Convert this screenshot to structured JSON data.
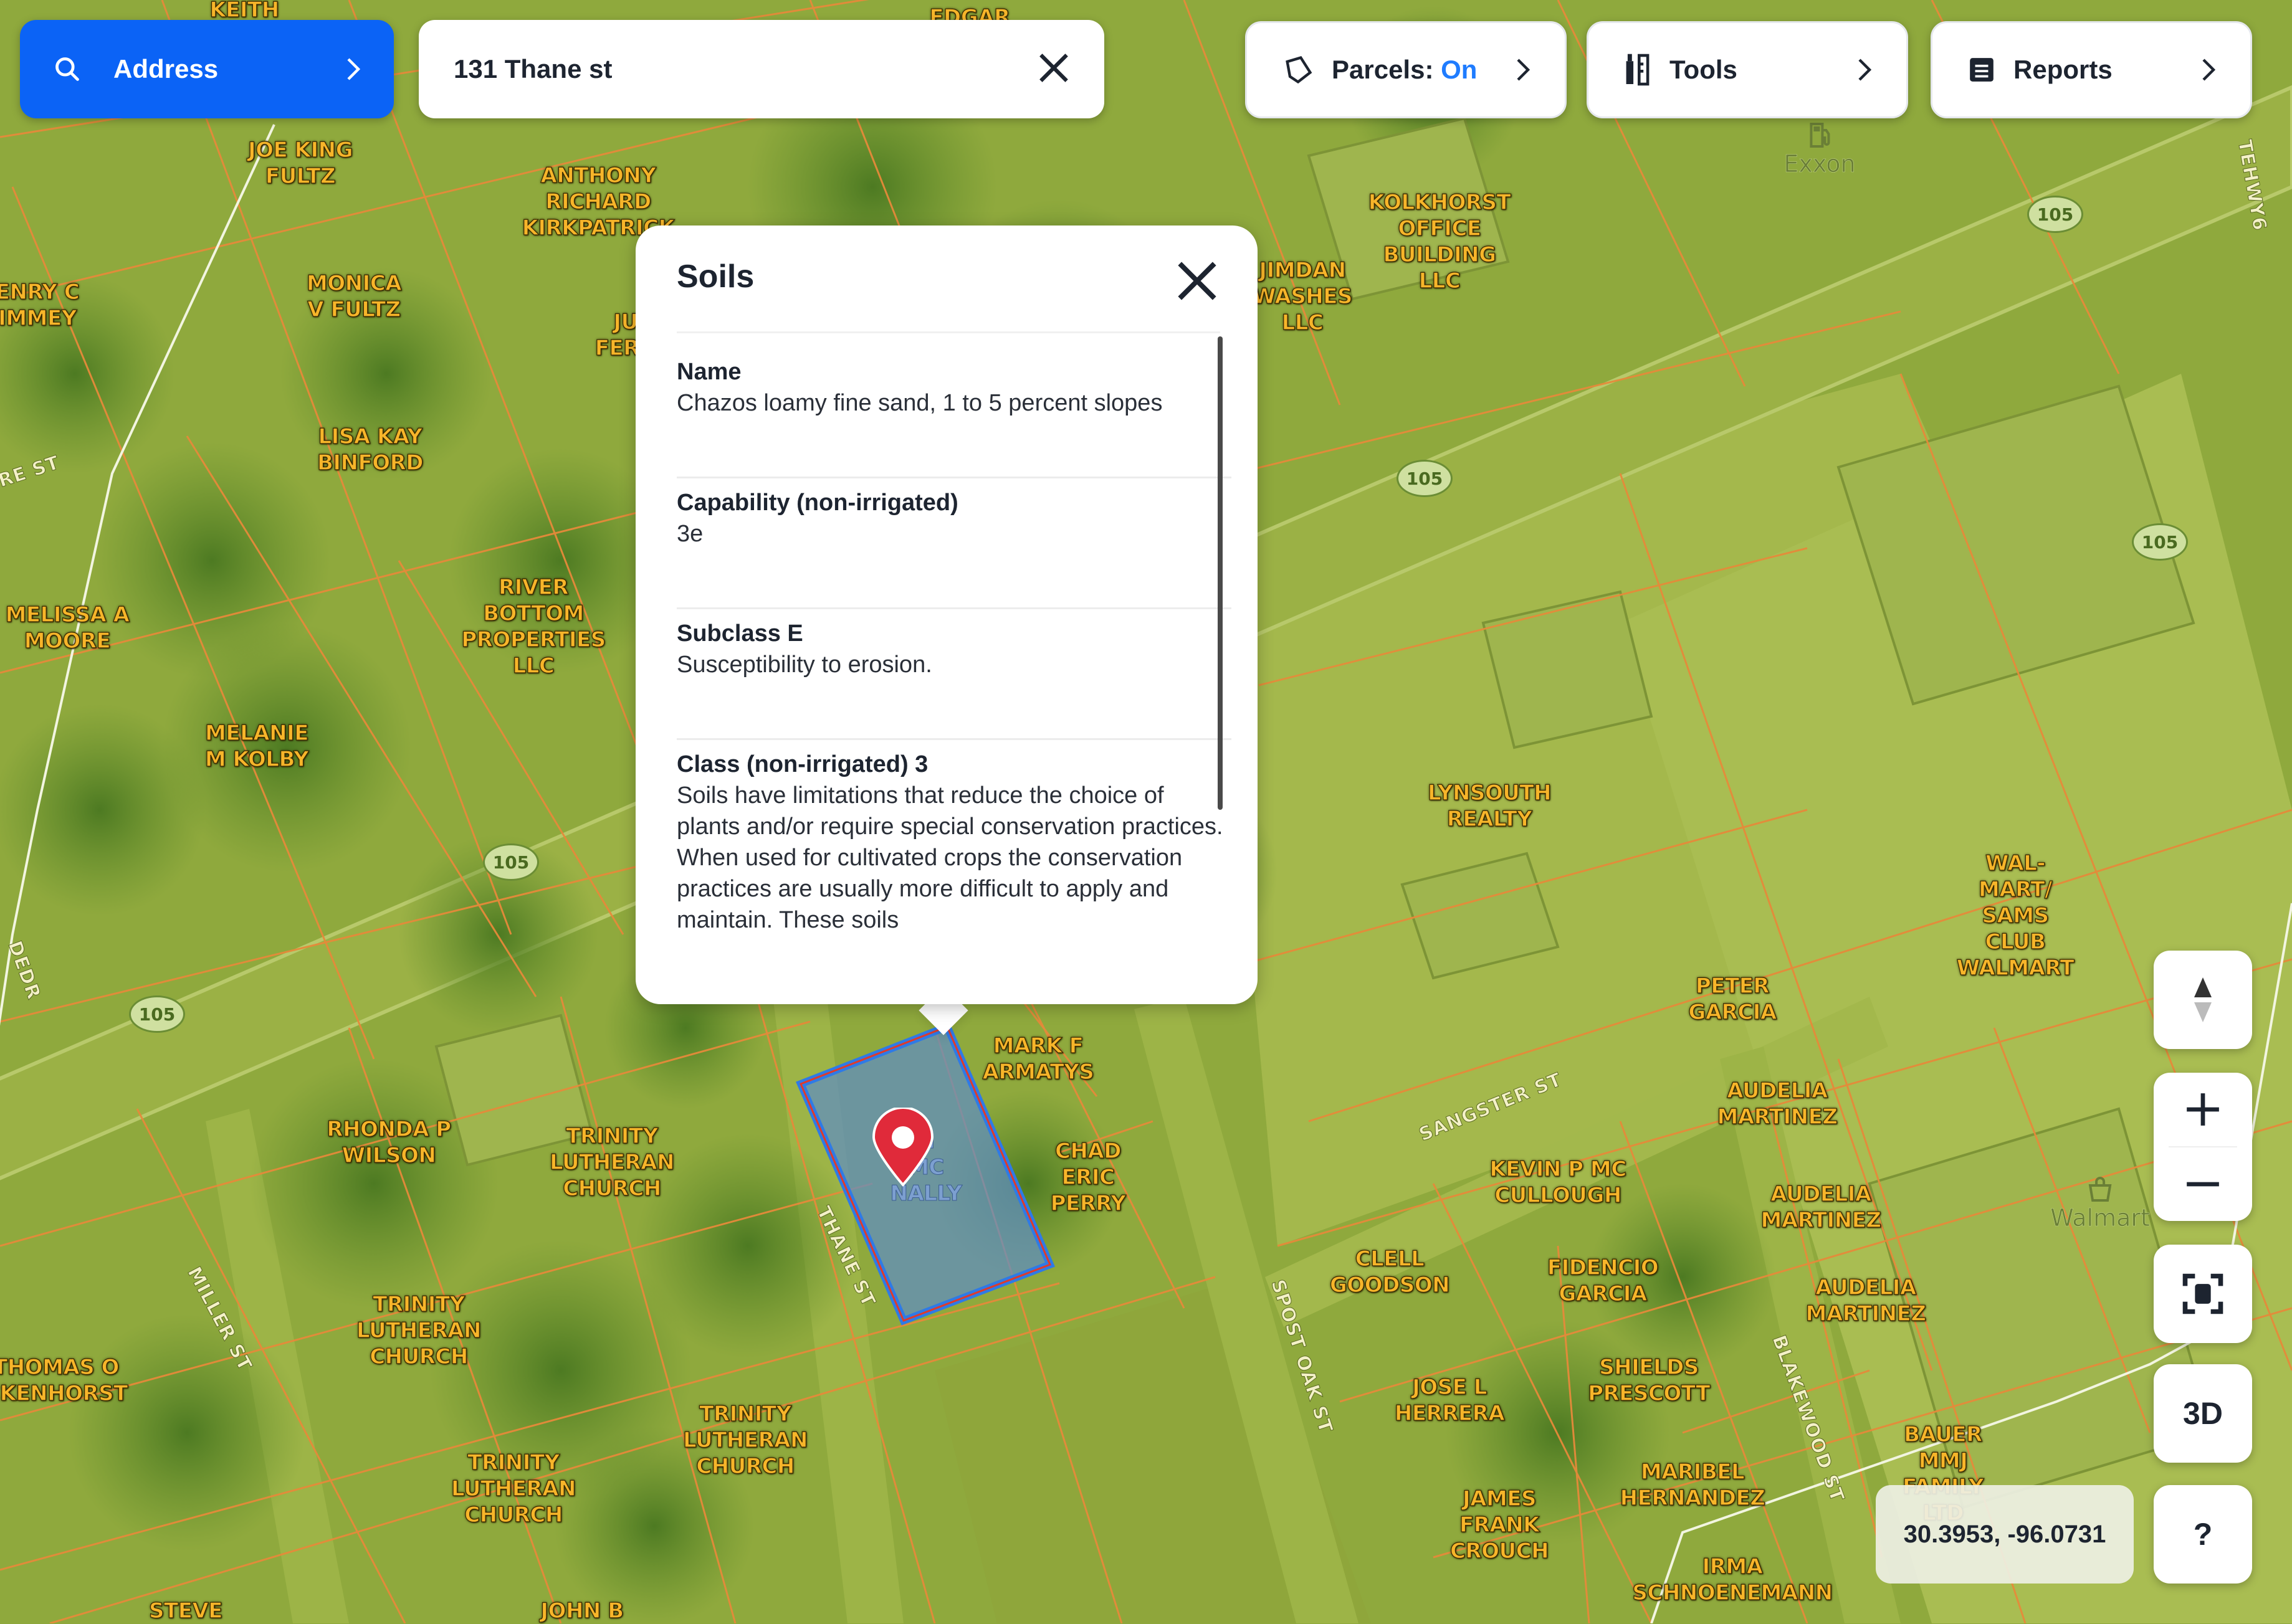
{
  "toolbar": {
    "address_label": "Address",
    "search_value": "131 Thane st",
    "parcels_label": "Parcels:",
    "parcels_state": "On",
    "tools_label": "Tools",
    "reports_label": "Reports"
  },
  "popup": {
    "title": "Soils",
    "fields": [
      {
        "label": "Name",
        "value": "Chazos loamy fine sand, 1 to 5 percent slopes"
      },
      {
        "label": "Capability (non-irrigated)",
        "value": "3e"
      },
      {
        "label": "Subclass E",
        "value": "Susceptibility to erosion."
      },
      {
        "label": "Class (non-irrigated) 3",
        "value": "Soils have limitations that reduce the choice of plants and/or require special conservation practices. When used for cultivated crops the conservation practices are usually more difficult to apply and maintain. These soils"
      }
    ]
  },
  "map": {
    "parcels": [
      "KEITH",
      "JOE KING\nFULTZ",
      "ANTHONY\nRICHARD\nKIRKPATRICK",
      "ENRY C\nIMMEY",
      "MONICA\nV FULTZ",
      "JU\nFERG",
      "LISA KAY\nBINFORD",
      "RIVER\nBOTTOM\nPROPERTIES\nLLC",
      "MELISSA A\nMOORE",
      "MELANIE\nM KOLBY",
      "JIMDAN\nWASHES\nLLC",
      "KOLKHORST\nOFFICE\nBUILDING\nLLC",
      "LYNSOUTH\nREALTY",
      "WAL-\nMART/\nSAMS\nCLUB\nWALMART",
      "PETER\nGARCIA",
      "AUDELIA\nMARTINEZ",
      "AUDELIA\nMARTINEZ",
      "AUDELIA\nMARTINEZ",
      "MARK F\nARMATYS",
      "CHAD\nERIC\nPERRY",
      "RHONDA P\nWILSON",
      "TRINITY\nLUTHERAN\nCHURCH",
      "TRINITY\nLUTHERAN\nCHURCH",
      "TRINITY\nLUTHERAN\nCHURCH",
      "TRINITY\nLUTHERAN\nCHURCH",
      "THOMAS O\nCKENHORST",
      "KEVIN P MC\nCULLOUGH",
      "CLELL\nGOODSON",
      "FIDENCIO\nGARCIA",
      "JOSE L\nHERRERA",
      "SHIELDS\nPRESCOTT",
      "JAMES\nFRANK\nCROUCH",
      "MARIBEL\nHERNANDEZ",
      "BAUER\nMMJ\nFAMILY\nLTD",
      "IRMA\nSCHNOENEMANN",
      "STEVE",
      "JOHN B",
      "EDGAR"
    ],
    "selected_parcel": "N\nMC\nNALLY",
    "streets": [
      "RE ST",
      "SANGSTER ST",
      "THANE ST",
      "MILLER ST",
      "SPOST OAK ST",
      "BLAKEWOOD ST",
      "DEDR",
      "TEHWY6"
    ],
    "route_number": "105",
    "pois": [
      "Exxon",
      "Walmart"
    ]
  },
  "controls": {
    "three_d_label": "3D",
    "help_label": "?",
    "coordinates": "30.3953, -96.0731"
  }
}
